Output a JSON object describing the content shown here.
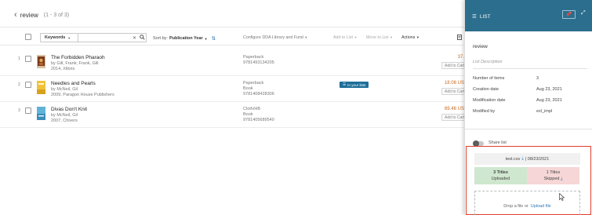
{
  "header": {
    "back_icon": "chevron-left-icon",
    "title": "review",
    "count": "(1 - 3 of 3)"
  },
  "toolbar": {
    "search_scope": "Keywords",
    "search_value": "",
    "search_placeholder": "",
    "sort_label": "Sort by:",
    "sort_value": "Publication Year",
    "configure": "Configure DDA Library and Fund",
    "add_to_list": "Add to List",
    "move_to_list": "Move to List",
    "actions": "Actions"
  },
  "rows": [
    {
      "num": "1",
      "title": "The Forbidden Pharaoh",
      "author": "by Gill, Frank; Frank, Gill",
      "pub": "2014, Xlibris",
      "format": [
        "Paperback",
        "9781493134205"
      ],
      "badge": "",
      "price": "37.",
      "cart": "Add to Cart",
      "cover_color": "#7b3b1b"
    },
    {
      "num": "2",
      "title": "Needles and Pearls",
      "author": "by McNeil, Gil",
      "pub": "2009, Paragon House Publishers",
      "format": [
        "Paperback",
        "Book",
        "9781408428306"
      ],
      "badge": "In your lists",
      "price": "18.06 US",
      "cart": "Add to Cart",
      "cover_color": "#d9a21c"
    },
    {
      "num": "3",
      "title": "Divas Don't Knit",
      "author": "by McNeil, Gil",
      "pub": "2007, Chivers",
      "format": [
        "Cloth/HB",
        "Book",
        "9781405689540"
      ],
      "badge": "",
      "price": "69.46 US",
      "cart": "Add to Cart",
      "cover_color": "#3a8db8"
    }
  ],
  "panel": {
    "header_label": "LIST",
    "name": "review",
    "description_placeholder": "List Description",
    "details": [
      {
        "key": "Number of items",
        "value": "3"
      },
      {
        "key": "Creation date",
        "value": "Aug 23, 2021"
      },
      {
        "key": "Modification date",
        "value": "Aug 23, 2021"
      },
      {
        "key": "Modified by",
        "value": "exl_impl"
      }
    ],
    "share_label": "Share list",
    "upload": {
      "file_name": "test.csv",
      "date": "| 08/23/2021",
      "uploaded_count": "3 Titles",
      "uploaded_label": "Uploaded",
      "skipped_count": "1 Titles",
      "skipped_label": "Skipped",
      "drop_text": "Drop a file or",
      "upload_link": "Upload file"
    }
  }
}
